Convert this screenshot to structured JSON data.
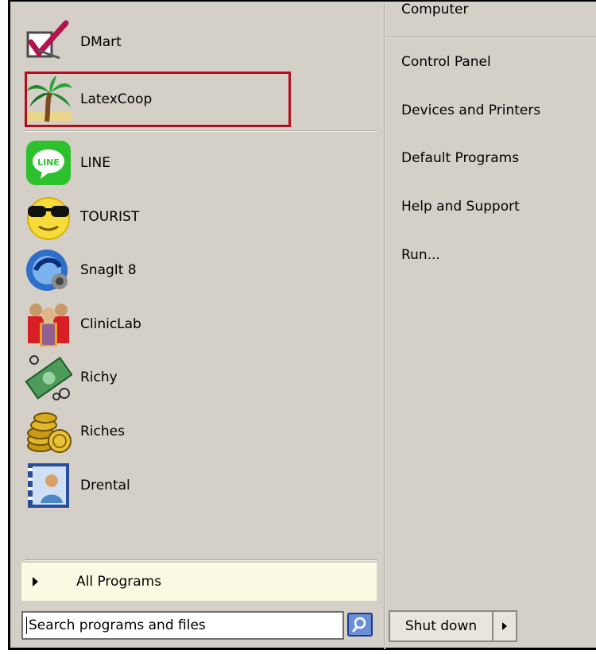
{
  "pinned": [
    {
      "label": "DMart",
      "icon": "dmart-checkbox-icon"
    },
    {
      "label": "LatexCoop",
      "icon": "palm-tree-icon"
    }
  ],
  "recent": [
    {
      "label": "LINE",
      "icon": "line-chat-icon"
    },
    {
      "label": "TOURIST",
      "icon": "sunglasses-smiley-icon"
    },
    {
      "label": "SnagIt 8",
      "icon": "snagit-icon"
    },
    {
      "label": "ClinicLab",
      "icon": "people-group-icon"
    },
    {
      "label": "Richy",
      "icon": "money-bill-icon"
    },
    {
      "label": "Riches",
      "icon": "gold-coins-icon"
    },
    {
      "label": "Drental",
      "icon": "contact-card-icon"
    }
  ],
  "all_programs": "All Programs",
  "search": {
    "placeholder": "Search programs and files"
  },
  "right": {
    "computer": "Computer",
    "control_panel": "Control Panel",
    "devices_printers": "Devices and Printers",
    "default_programs": "Default Programs",
    "help_support": "Help and Support",
    "run": "Run..."
  },
  "shutdown": {
    "label": "Shut down"
  },
  "colors": {
    "highlight": "#b50d1a",
    "panel": "#d4d0c8",
    "all_programs_bg": "#fcfae3"
  }
}
